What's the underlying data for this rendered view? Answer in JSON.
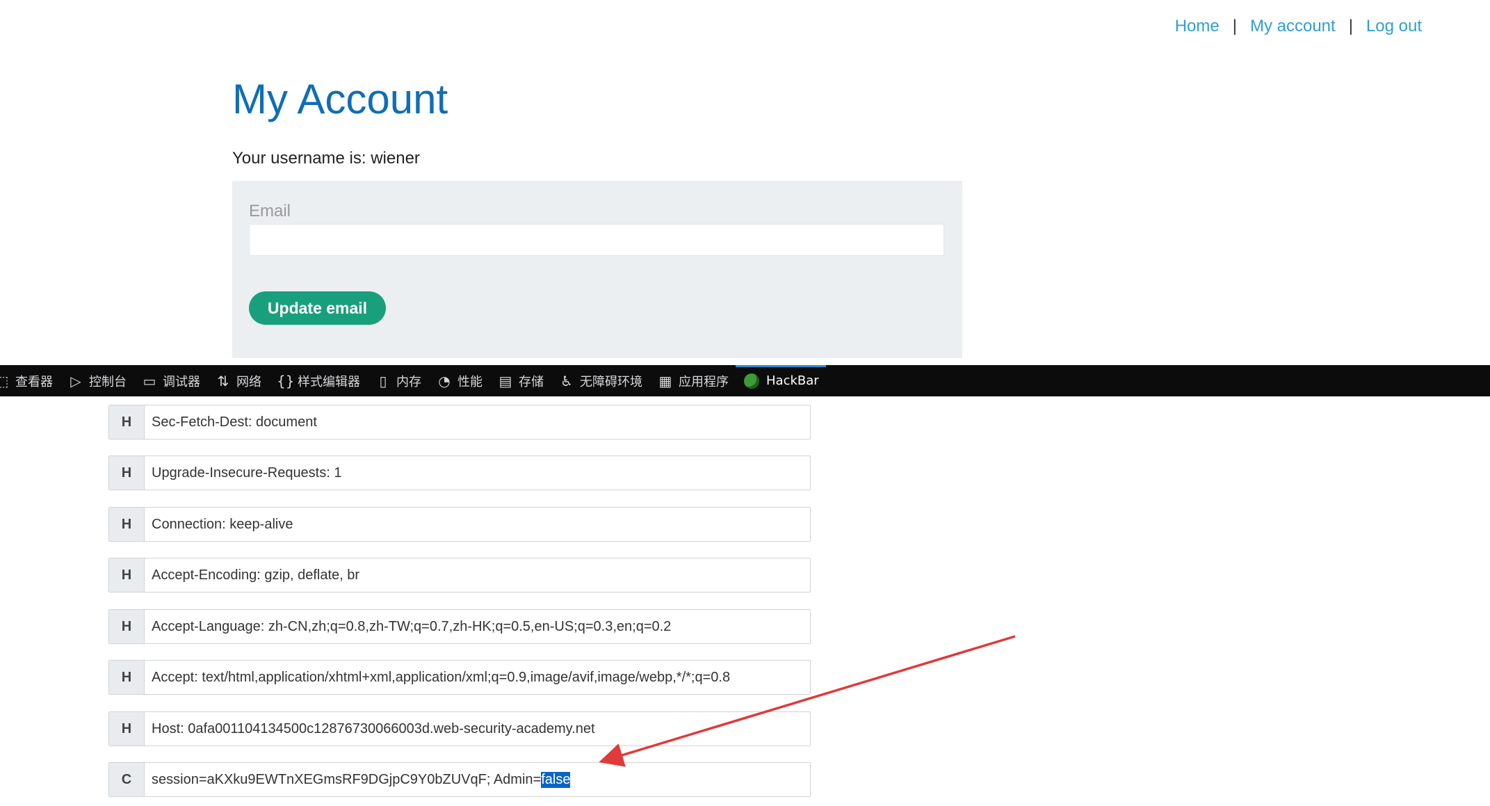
{
  "nav": {
    "home": "Home",
    "my_account": "My account",
    "log_out": "Log out",
    "separator": "|"
  },
  "page": {
    "title": "My Account",
    "username_line": "Your username is: wiener",
    "email_label": "Email",
    "email_value": "",
    "update_button": "Update email"
  },
  "devtools": {
    "tabs": [
      {
        "label": "查看器",
        "icon": "inspector-icon"
      },
      {
        "label": "控制台",
        "icon": "console-icon"
      },
      {
        "label": "调试器",
        "icon": "debugger-icon"
      },
      {
        "label": "网络",
        "icon": "network-icon"
      },
      {
        "label": "样式编辑器",
        "icon": "style-editor-icon"
      },
      {
        "label": "内存",
        "icon": "memory-icon"
      },
      {
        "label": "性能",
        "icon": "performance-icon"
      },
      {
        "label": "存储",
        "icon": "storage-icon"
      },
      {
        "label": "无障碍环境",
        "icon": "accessibility-icon"
      },
      {
        "label": "应用程序",
        "icon": "application-icon"
      },
      {
        "label": "HackBar",
        "icon": "hackbar-icon",
        "active": true
      }
    ]
  },
  "hackbar": {
    "headers": [
      {
        "type": "H",
        "value": "Sec-Fetch-Dest: document"
      },
      {
        "type": "H",
        "value": "Upgrade-Insecure-Requests: 1"
      },
      {
        "type": "H",
        "value": "Connection: keep-alive"
      },
      {
        "type": "H",
        "value": "Accept-Encoding: gzip, deflate, br"
      },
      {
        "type": "H",
        "value": "Accept-Language: zh-CN,zh;q=0.8,zh-TW;q=0.7,zh-HK;q=0.5,en-US;q=0.3,en;q=0.2"
      },
      {
        "type": "H",
        "value": "Accept: text/html,application/xhtml+xml,application/xml;q=0.9,image/avif,image/webp,*/*;q=0.8"
      },
      {
        "type": "H",
        "value": "Host: 0afa001104134500c12876730066003d.web-security-academy.net"
      }
    ],
    "cookie": {
      "type": "C",
      "prefix": "session=aKXku9EWTnXEGmsRF9DGjpC9Y0bZUVqF; Admin=",
      "selected": "false"
    }
  },
  "colors": {
    "link": "#2e9fd4",
    "title": "#0f6eb5",
    "button": "#18a07d",
    "annotation_arrow": "#e03a3a",
    "selection": "#0a64c8"
  }
}
